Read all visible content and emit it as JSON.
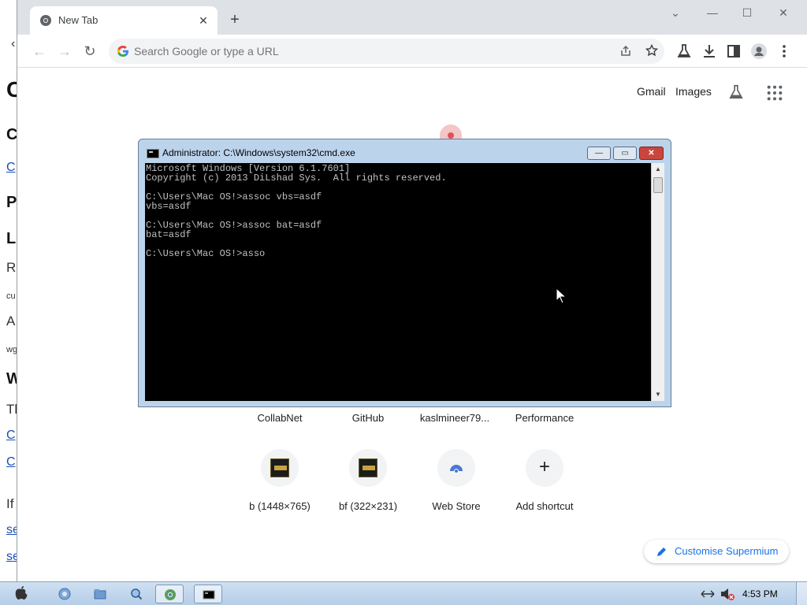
{
  "background_page": {
    "fragments": [
      "C",
      "C",
      "C",
      "P",
      "L",
      "R",
      "cu",
      "A",
      "wg",
      "W",
      "Tl",
      "C",
      "C",
      "If",
      "se",
      "se"
    ]
  },
  "browser": {
    "tab": {
      "title": "New Tab",
      "close_glyph": "✕",
      "icon": "chromium-icon"
    },
    "new_tab_glyph": "+",
    "window_controls": {
      "dropdown": "⌄",
      "minimize": "—",
      "maximize": "☐",
      "close": "✕"
    },
    "toolbar": {
      "back": "←",
      "forward": "→",
      "reload": "↻",
      "omnibox_placeholder": "Search Google or type a URL",
      "icons": [
        "share-icon",
        "bookmark-star-icon",
        "labs-icon",
        "download-icon",
        "side-panel-icon",
        "profile-icon",
        "menu-icon"
      ]
    }
  },
  "ntp": {
    "links": {
      "gmail": "Gmail",
      "images": "Images"
    },
    "shortcuts_row1": [
      "CollabNet",
      "GitHub",
      "kaslmineer79...",
      "Performance"
    ],
    "shortcuts_row2": [
      "b (1448×765)",
      "bf (322×231)",
      "Web Store",
      "Add shortcut"
    ],
    "add_glyph": "+",
    "customise_label": "Customise Supermium"
  },
  "cmd": {
    "title": "Administrator: C:\\Windows\\system32\\cmd.exe",
    "buttons": {
      "minimize": "—",
      "maximize": "▭",
      "close": "✕"
    },
    "console_text": "Microsoft Windows [Version 6.1.7601]\nCopyright (c) 2013 DiLshad Sys.  All rights reserved.\n\nC:\\Users\\Mac OS!>assoc vbs=asdf\nvbs=asdf\n\nC:\\Users\\Mac OS!>assoc bat=asdf\nbat=asdf\n\nC:\\Users\\Mac OS!>asso",
    "scroll_up": "▲",
    "scroll_down": "▼"
  },
  "taskbar": {
    "apps": [
      "apple-start-icon",
      "finder-icon",
      "folder-icon",
      "search-icon",
      "chrome-icon",
      "cmd-icon"
    ],
    "clock": "4:53 PM"
  },
  "colors": {
    "cmd_frame": "#bcd3ec",
    "cmd_close": "#c9463d",
    "link_blue": "#1a73e8"
  }
}
